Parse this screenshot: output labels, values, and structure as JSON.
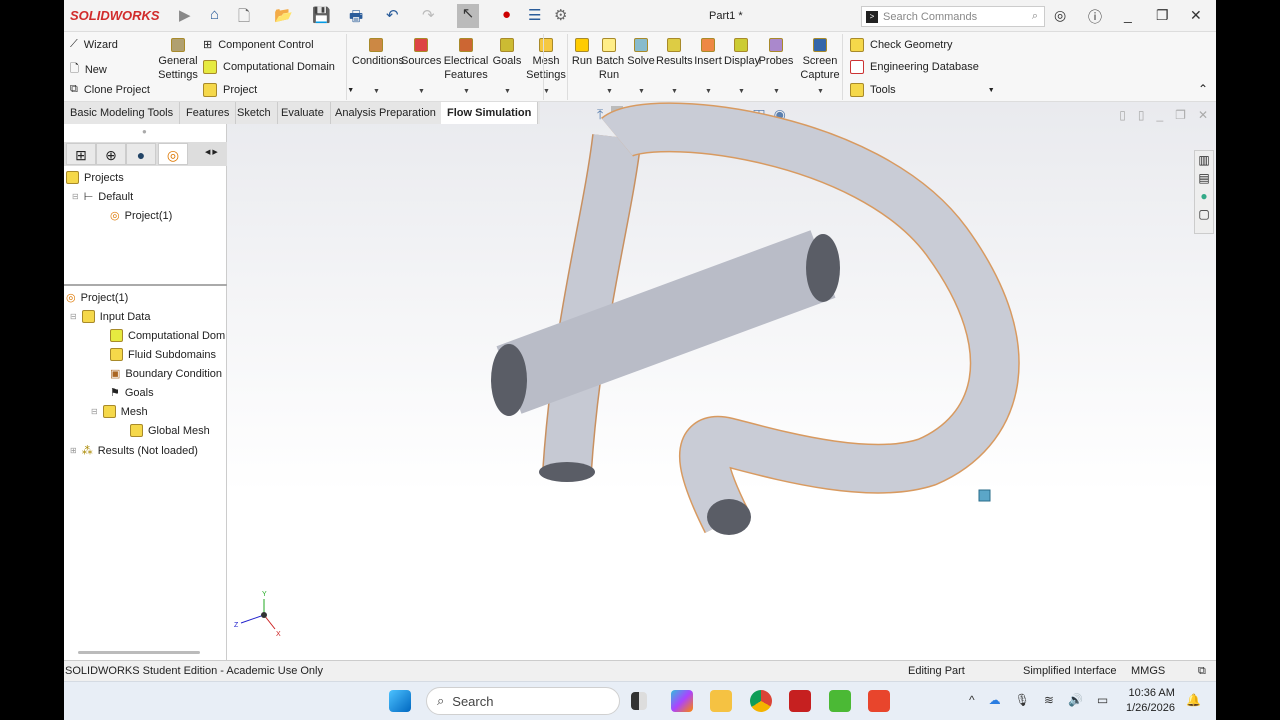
{
  "titlebar": {
    "brand": "SOLIDWORKS",
    "document": "Part1 *",
    "search_placeholder": "Search Commands"
  },
  "ribbon": {
    "left": [
      "Wizard",
      "New",
      "Clone Project"
    ],
    "general": "General Settings",
    "mid": [
      "Component Control",
      "Computational Domain",
      "Project"
    ],
    "big": [
      "Conditions",
      "Sources",
      "Electrical Features",
      "Goals",
      "Mesh Settings",
      "Run",
      "Batch Run",
      "Solve",
      "Results",
      "Insert",
      "Display",
      "Probes",
      "Screen Capture"
    ],
    "right": [
      "Check Geometry",
      "Engineering Database",
      "Tools"
    ]
  },
  "tabs": [
    "Basic Modeling Tools",
    "Features",
    "Sketch",
    "Evaluate",
    "Analysis Preparation",
    "Flow Simulation"
  ],
  "tree_top": [
    "Projects",
    "Default",
    "Project(1)"
  ],
  "tree_bottom": [
    "Project(1)",
    "Input Data",
    "Computational Dom",
    "Fluid Subdomains",
    "Boundary Condition",
    "Goals",
    "Mesh",
    "Global Mesh",
    "Results (Not loaded)"
  ],
  "status": {
    "edition": "SOLIDWORKS Student Edition - Academic Use Only",
    "mode": "Editing Part",
    "interface": "Simplified Interface",
    "units": "MMGS"
  },
  "taskbar": {
    "search": "Search",
    "time": "10:36 AM",
    "date": "1/26/2026"
  },
  "triad": {
    "x": "X",
    "y": "Y",
    "z": "Z"
  }
}
